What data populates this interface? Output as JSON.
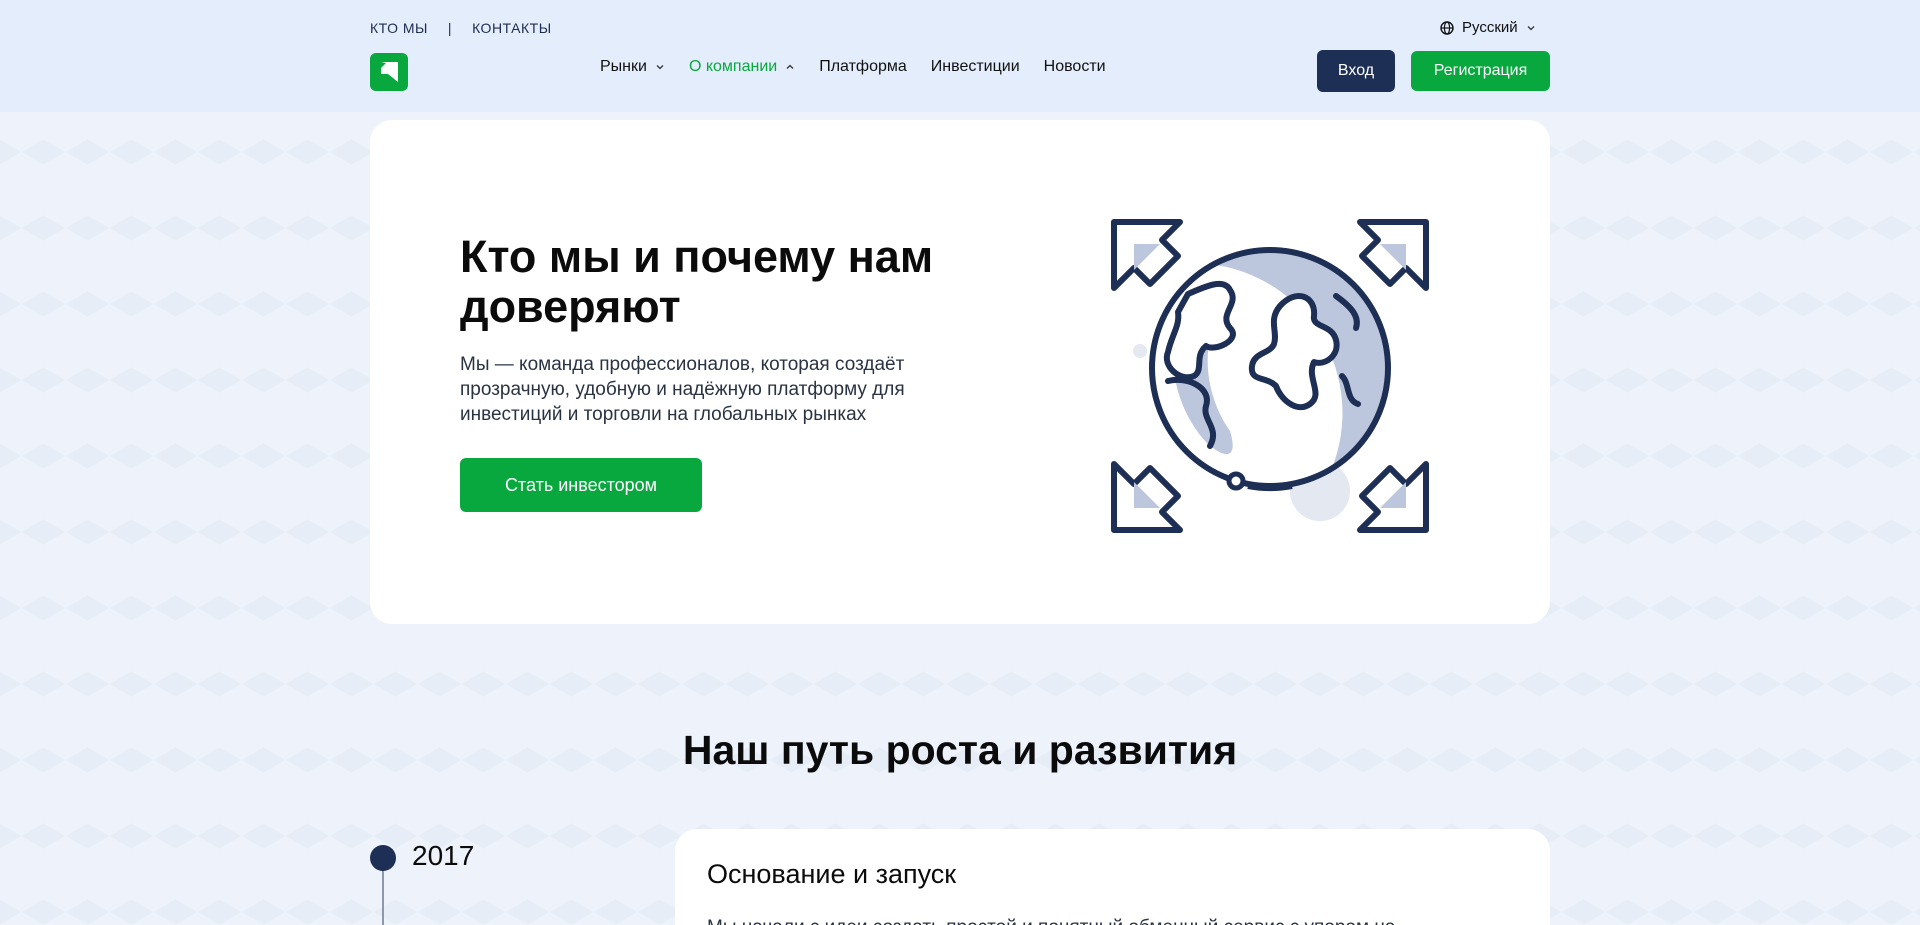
{
  "topbar": {
    "about_link": "КТО МЫ",
    "separator": "|",
    "contacts_link": "КОНТАКТЫ"
  },
  "language": {
    "label": "Русский",
    "icon": "globe-icon"
  },
  "nav": {
    "items": [
      {
        "label": "Рынки",
        "has_dropdown": true,
        "active": false
      },
      {
        "label": "О компании",
        "has_dropdown": true,
        "active": true
      },
      {
        "label": "Платформа",
        "has_dropdown": false,
        "active": false
      },
      {
        "label": "Инвестиции",
        "has_dropdown": false,
        "active": false
      },
      {
        "label": "Новости",
        "has_dropdown": false,
        "active": false
      }
    ]
  },
  "auth": {
    "login_label": "Вход",
    "register_label": "Регистрация"
  },
  "hero": {
    "title": "Кто мы и почему нам доверяют",
    "description": "Мы — команда профессионалов, которая создаёт прозрачную, удобную и надёжную платформу для инвестиций и торговли на глобальных рынках",
    "cta_label": "Стать инвестором",
    "illustration": "globe-with-expand-arrows-icon"
  },
  "growth": {
    "title": "Наш путь роста и развития",
    "stages": [
      {
        "year": "2017",
        "title": "Основание и запуск",
        "text": "Мы начали с идеи создать простой и понятный обменный сервис с упором на"
      }
    ]
  },
  "colors": {
    "accent_green": "#08a83e",
    "navy": "#1e2f55",
    "header_bg": "#e3edfc",
    "page_bg": "#eef3fb",
    "card_bg": "#ffffff"
  }
}
